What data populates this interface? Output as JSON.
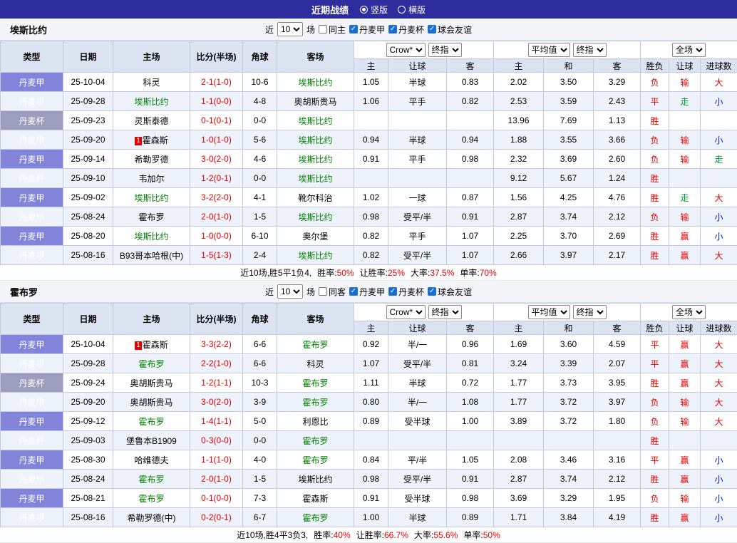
{
  "topbar": {
    "title": "近期战绩",
    "vertical": "竖版",
    "horizontal": "横版"
  },
  "labels": {
    "near": "近",
    "games": "场"
  },
  "filters": {
    "count": "10",
    "leagues": [
      "丹麦甲",
      "丹麦杯",
      "球会友谊"
    ]
  },
  "selects": {
    "bookmaker": "Crow*",
    "final": "终指",
    "average": "平均值",
    "fulltime": "全场"
  },
  "columns": {
    "type": "类型",
    "date": "日期",
    "home": "主场",
    "score": "比分(半场)",
    "corner": "角球",
    "away": "客场",
    "h": "主",
    "handicap": "让球",
    "a": "客",
    "draw": "和",
    "result": "胜负",
    "goals": "进球数"
  },
  "colors": {
    "accent_navy": "#2D2D9E",
    "league_cell": "#8284D9",
    "cup_cell": "#9D9DBD",
    "win_red": "#e60000",
    "push_green": "#009933",
    "under_blue": "#0022cc",
    "team_green": "#008000"
  },
  "sections": [
    {
      "team": "埃斯比约",
      "same_label": "同主",
      "rows": [
        {
          "type": "丹麦甲",
          "cup": false,
          "date": "25-10-04",
          "home": "科灵",
          "hBadge": "",
          "hHl": false,
          "score": "2-1(1-0)",
          "corner": "10-6",
          "away": "埃斯比约",
          "aHl": true,
          "ah": [
            "1.05",
            "半球",
            "0.83"
          ],
          "eu": [
            "2.02",
            "3.50",
            "3.29"
          ],
          "res": [
            "负",
            "输",
            "大"
          ],
          "resC": [
            "r",
            "r",
            "r"
          ]
        },
        {
          "type": "丹麦甲",
          "cup": false,
          "date": "25-09-28",
          "home": "埃斯比约",
          "hBadge": "",
          "hHl": true,
          "score": "1-1(0-0)",
          "corner": "4-8",
          "away": "奥胡斯贵马",
          "aHl": false,
          "ah": [
            "1.06",
            "平手",
            "0.82"
          ],
          "eu": [
            "2.53",
            "3.59",
            "2.43"
          ],
          "res": [
            "平",
            "走",
            "小"
          ],
          "resC": [
            "r",
            "g",
            "b"
          ]
        },
        {
          "type": "丹麦杯",
          "cup": true,
          "date": "25-09-23",
          "home": "灵斯泰德",
          "hBadge": "",
          "hHl": false,
          "score": "0-1(0-1)",
          "corner": "0-0",
          "away": "埃斯比约",
          "aHl": true,
          "ah": [
            "",
            "",
            ""
          ],
          "eu": [
            "13.96",
            "7.69",
            "1.13"
          ],
          "res": [
            "胜",
            "",
            ""
          ],
          "resC": [
            "r",
            "",
            ""
          ]
        },
        {
          "type": "丹麦甲",
          "cup": false,
          "date": "25-09-20",
          "home": "霍森斯",
          "hBadge": "1",
          "hHl": false,
          "score": "1-0(1-0)",
          "corner": "5-6",
          "away": "埃斯比约",
          "aHl": true,
          "ah": [
            "0.94",
            "半球",
            "0.94"
          ],
          "eu": [
            "1.88",
            "3.55",
            "3.66"
          ],
          "res": [
            "负",
            "输",
            "小"
          ],
          "resC": [
            "r",
            "r",
            "b"
          ]
        },
        {
          "type": "丹麦甲",
          "cup": false,
          "date": "25-09-14",
          "home": "希勒罗德",
          "hBadge": "",
          "hHl": false,
          "score": "3-0(2-0)",
          "corner": "4-6",
          "away": "埃斯比约",
          "aHl": true,
          "ah": [
            "0.91",
            "平手",
            "0.98"
          ],
          "eu": [
            "2.32",
            "3.69",
            "2.60"
          ],
          "res": [
            "负",
            "输",
            "走"
          ],
          "resC": [
            "r",
            "r",
            "g"
          ]
        },
        {
          "type": "丹麦杯",
          "cup": true,
          "date": "25-09-10",
          "home": "韦加尔",
          "hBadge": "",
          "hHl": false,
          "score": "1-2(0-1)",
          "corner": "0-0",
          "away": "埃斯比约",
          "aHl": true,
          "ah": [
            "",
            "",
            ""
          ],
          "eu": [
            "9.12",
            "5.67",
            "1.24"
          ],
          "res": [
            "胜",
            "",
            ""
          ],
          "resC": [
            "r",
            "",
            ""
          ]
        },
        {
          "type": "丹麦甲",
          "cup": false,
          "date": "25-09-02",
          "home": "埃斯比约",
          "hBadge": "",
          "hHl": true,
          "score": "3-2(2-0)",
          "corner": "4-1",
          "away": "靴尔科治",
          "aHl": false,
          "ah": [
            "1.02",
            "一球",
            "0.87"
          ],
          "eu": [
            "1.56",
            "4.25",
            "4.76"
          ],
          "res": [
            "胜",
            "走",
            "大"
          ],
          "resC": [
            "r",
            "g",
            "r"
          ]
        },
        {
          "type": "丹麦甲",
          "cup": false,
          "date": "25-08-24",
          "home": "霍布罗",
          "hBadge": "",
          "hHl": false,
          "score": "2-0(1-0)",
          "corner": "1-5",
          "away": "埃斯比约",
          "aHl": true,
          "ah": [
            "0.98",
            "受平/半",
            "0.91"
          ],
          "eu": [
            "2.87",
            "3.74",
            "2.12"
          ],
          "res": [
            "负",
            "输",
            "小"
          ],
          "resC": [
            "r",
            "r",
            "b"
          ]
        },
        {
          "type": "丹麦甲",
          "cup": false,
          "date": "25-08-20",
          "home": "埃斯比约",
          "hBadge": "",
          "hHl": true,
          "score": "1-0(0-0)",
          "corner": "6-10",
          "away": "奥尔堡",
          "aHl": false,
          "ah": [
            "0.82",
            "平手",
            "1.07"
          ],
          "eu": [
            "2.25",
            "3.70",
            "2.69"
          ],
          "res": [
            "胜",
            "赢",
            "小"
          ],
          "resC": [
            "r",
            "r",
            "b"
          ]
        },
        {
          "type": "丹麦甲",
          "cup": false,
          "date": "25-08-16",
          "home": "B93哥本哈根(中)",
          "hBadge": "",
          "hHl": false,
          "score": "1-5(1-3)",
          "corner": "2-4",
          "away": "埃斯比约",
          "aHl": true,
          "ah": [
            "0.82",
            "受平/半",
            "1.07"
          ],
          "eu": [
            "2.66",
            "3.97",
            "2.17"
          ],
          "res": [
            "胜",
            "赢",
            "大"
          ],
          "resC": [
            "r",
            "r",
            "r"
          ]
        }
      ],
      "summary": {
        "prefix": "近10场,胜5平1负4,",
        "stats": [
          [
            "胜率:",
            "50%"
          ],
          [
            "让胜率:",
            "25%"
          ],
          [
            "大率:",
            "37.5%"
          ],
          [
            "单率:",
            "70%"
          ]
        ]
      }
    },
    {
      "team": "霍布罗",
      "same_label": "同客",
      "rows": [
        {
          "type": "丹麦甲",
          "cup": false,
          "date": "25-10-04",
          "home": "霍森斯",
          "hBadge": "1",
          "hHl": false,
          "score": "3-3(2-2)",
          "corner": "6-6",
          "away": "霍布罗",
          "aHl": true,
          "ah": [
            "0.92",
            "半/一",
            "0.96"
          ],
          "eu": [
            "1.69",
            "3.60",
            "4.59"
          ],
          "res": [
            "平",
            "赢",
            "大"
          ],
          "resC": [
            "r",
            "r",
            "r"
          ]
        },
        {
          "type": "丹麦甲",
          "cup": false,
          "date": "25-09-28",
          "home": "霍布罗",
          "hBadge": "",
          "hHl": true,
          "score": "2-2(1-0)",
          "corner": "6-6",
          "away": "科灵",
          "aHl": false,
          "ah": [
            "1.07",
            "受平/半",
            "0.81"
          ],
          "eu": [
            "3.24",
            "3.39",
            "2.07"
          ],
          "res": [
            "平",
            "赢",
            "大"
          ],
          "resC": [
            "r",
            "r",
            "r"
          ]
        },
        {
          "type": "丹麦杯",
          "cup": true,
          "date": "25-09-24",
          "home": "奥胡斯贵马",
          "hBadge": "",
          "hHl": false,
          "score": "1-2(1-1)",
          "corner": "10-3",
          "away": "霍布罗",
          "aHl": true,
          "ah": [
            "1.11",
            "半球",
            "0.72"
          ],
          "eu": [
            "1.77",
            "3.73",
            "3.95"
          ],
          "res": [
            "胜",
            "赢",
            "大"
          ],
          "resC": [
            "r",
            "r",
            "r"
          ]
        },
        {
          "type": "丹麦甲",
          "cup": false,
          "date": "25-09-20",
          "home": "奥胡斯贵马",
          "hBadge": "",
          "hHl": false,
          "score": "3-0(2-0)",
          "corner": "3-9",
          "away": "霍布罗",
          "aHl": true,
          "ah": [
            "0.80",
            "半/一",
            "1.08"
          ],
          "eu": [
            "1.77",
            "3.72",
            "3.97"
          ],
          "res": [
            "负",
            "输",
            "大"
          ],
          "resC": [
            "r",
            "r",
            "r"
          ]
        },
        {
          "type": "丹麦甲",
          "cup": false,
          "date": "25-09-12",
          "home": "霍布罗",
          "hBadge": "",
          "hHl": true,
          "score": "1-4(1-1)",
          "corner": "5-0",
          "away": "利恩比",
          "aHl": false,
          "ah": [
            "0.89",
            "受半球",
            "1.00"
          ],
          "eu": [
            "3.89",
            "3.72",
            "1.80"
          ],
          "res": [
            "负",
            "输",
            "大"
          ],
          "resC": [
            "r",
            "r",
            "r"
          ]
        },
        {
          "type": "丹麦杯",
          "cup": true,
          "date": "25-09-03",
          "home": "堡鲁本B1909",
          "hBadge": "",
          "hHl": false,
          "score": "0-3(0-0)",
          "corner": "0-0",
          "away": "霍布罗",
          "aHl": true,
          "ah": [
            "",
            "",
            ""
          ],
          "eu": [
            "",
            "",
            ""
          ],
          "res": [
            "胜",
            "",
            ""
          ],
          "resC": [
            "r",
            "",
            ""
          ]
        },
        {
          "type": "丹麦甲",
          "cup": false,
          "date": "25-08-30",
          "home": "哈维德夫",
          "hBadge": "",
          "hHl": false,
          "score": "1-1(1-0)",
          "corner": "4-0",
          "away": "霍布罗",
          "aHl": true,
          "ah": [
            "0.84",
            "平/半",
            "1.05"
          ],
          "eu": [
            "2.08",
            "3.46",
            "3.16"
          ],
          "res": [
            "平",
            "赢",
            "小"
          ],
          "resC": [
            "r",
            "r",
            "b"
          ]
        },
        {
          "type": "丹麦甲",
          "cup": false,
          "date": "25-08-24",
          "home": "霍布罗",
          "hBadge": "",
          "hHl": true,
          "score": "2-0(1-0)",
          "corner": "1-5",
          "away": "埃斯比约",
          "aHl": false,
          "ah": [
            "0.98",
            "受平/半",
            "0.91"
          ],
          "eu": [
            "2.87",
            "3.74",
            "2.12"
          ],
          "res": [
            "胜",
            "赢",
            "小"
          ],
          "resC": [
            "r",
            "r",
            "b"
          ]
        },
        {
          "type": "丹麦甲",
          "cup": false,
          "date": "25-08-21",
          "home": "霍布罗",
          "hBadge": "",
          "hHl": true,
          "score": "0-1(0-0)",
          "corner": "7-3",
          "away": "霍森斯",
          "aHl": false,
          "ah": [
            "0.91",
            "受半球",
            "0.98"
          ],
          "eu": [
            "3.69",
            "3.29",
            "1.95"
          ],
          "res": [
            "负",
            "输",
            "小"
          ],
          "resC": [
            "r",
            "r",
            "b"
          ]
        },
        {
          "type": "丹麦甲",
          "cup": false,
          "date": "25-08-16",
          "home": "希勒罗德(中)",
          "hBadge": "",
          "hHl": false,
          "score": "0-2(0-1)",
          "corner": "6-7",
          "away": "霍布罗",
          "aHl": true,
          "ah": [
            "1.00",
            "半球",
            "0.89"
          ],
          "eu": [
            "1.71",
            "3.84",
            "4.19"
          ],
          "res": [
            "胜",
            "赢",
            "小"
          ],
          "resC": [
            "r",
            "r",
            "b"
          ]
        }
      ],
      "summary": {
        "prefix": "近10场,胜4平3负3,",
        "stats": [
          [
            "胜率:",
            "40%"
          ],
          [
            "让胜率:",
            "66.7%"
          ],
          [
            "大率:",
            "55.6%"
          ],
          [
            "单率:",
            "50%"
          ]
        ]
      }
    }
  ]
}
